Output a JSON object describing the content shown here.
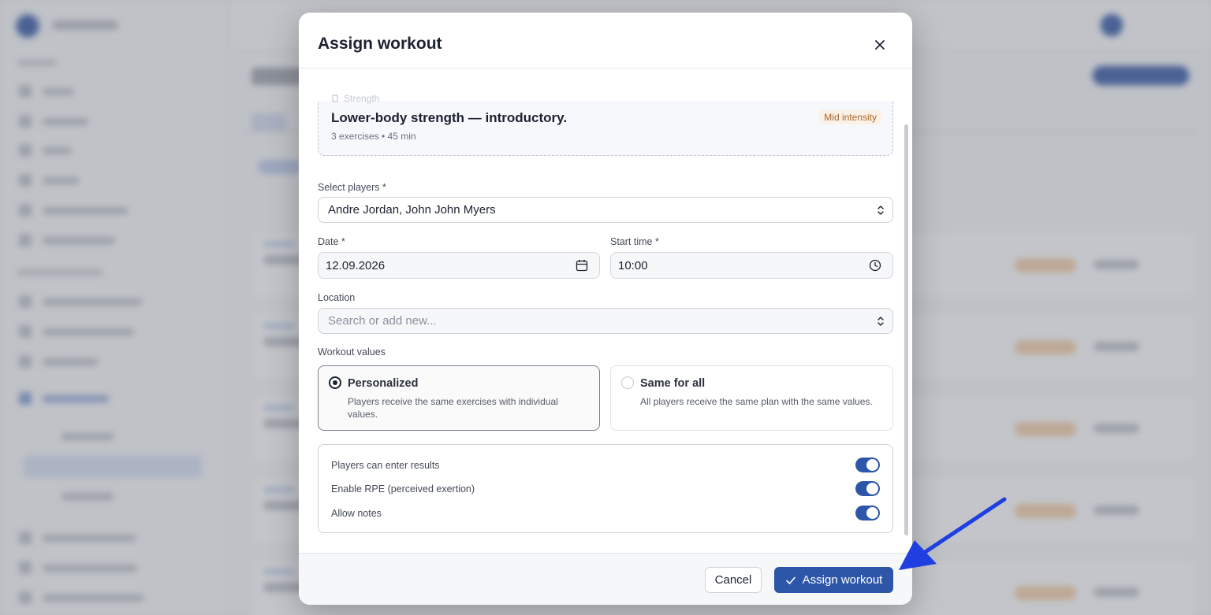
{
  "modal": {
    "title": "Assign workout",
    "workout": {
      "category": "Strength",
      "title": "Lower-body strength — introductory.",
      "meta": "3 exercises • 45 min",
      "intensity": "Mid intensity"
    },
    "players": {
      "label": "Select players *",
      "value": "Andre Jordan, John John Myers"
    },
    "date": {
      "label": "Date *",
      "value": "12.09.2026"
    },
    "start_time": {
      "label": "Start time  *",
      "value": "10:00"
    },
    "location": {
      "label": "Location",
      "placeholder": "Search or add new..."
    },
    "workout_values": {
      "label": "Workout values",
      "options": [
        {
          "title": "Personalized",
          "description": "Players receive the same exercises with individual values.",
          "selected": true
        },
        {
          "title": "Same for all",
          "description": "All players receive the same plan with the same values.",
          "selected": false
        }
      ]
    },
    "toggles": [
      {
        "label": "Players can enter results",
        "on": true
      },
      {
        "label": "Enable RPE (perceived exertion)",
        "on": true
      },
      {
        "label": "Allow notes",
        "on": true
      }
    ],
    "footer": {
      "cancel_label": "Cancel",
      "assign_label": "Assign workout"
    }
  },
  "colors": {
    "primary": "#2d56a8",
    "annotation_arrow": "#1f3fe0",
    "intensity_text": "#a8662c"
  }
}
